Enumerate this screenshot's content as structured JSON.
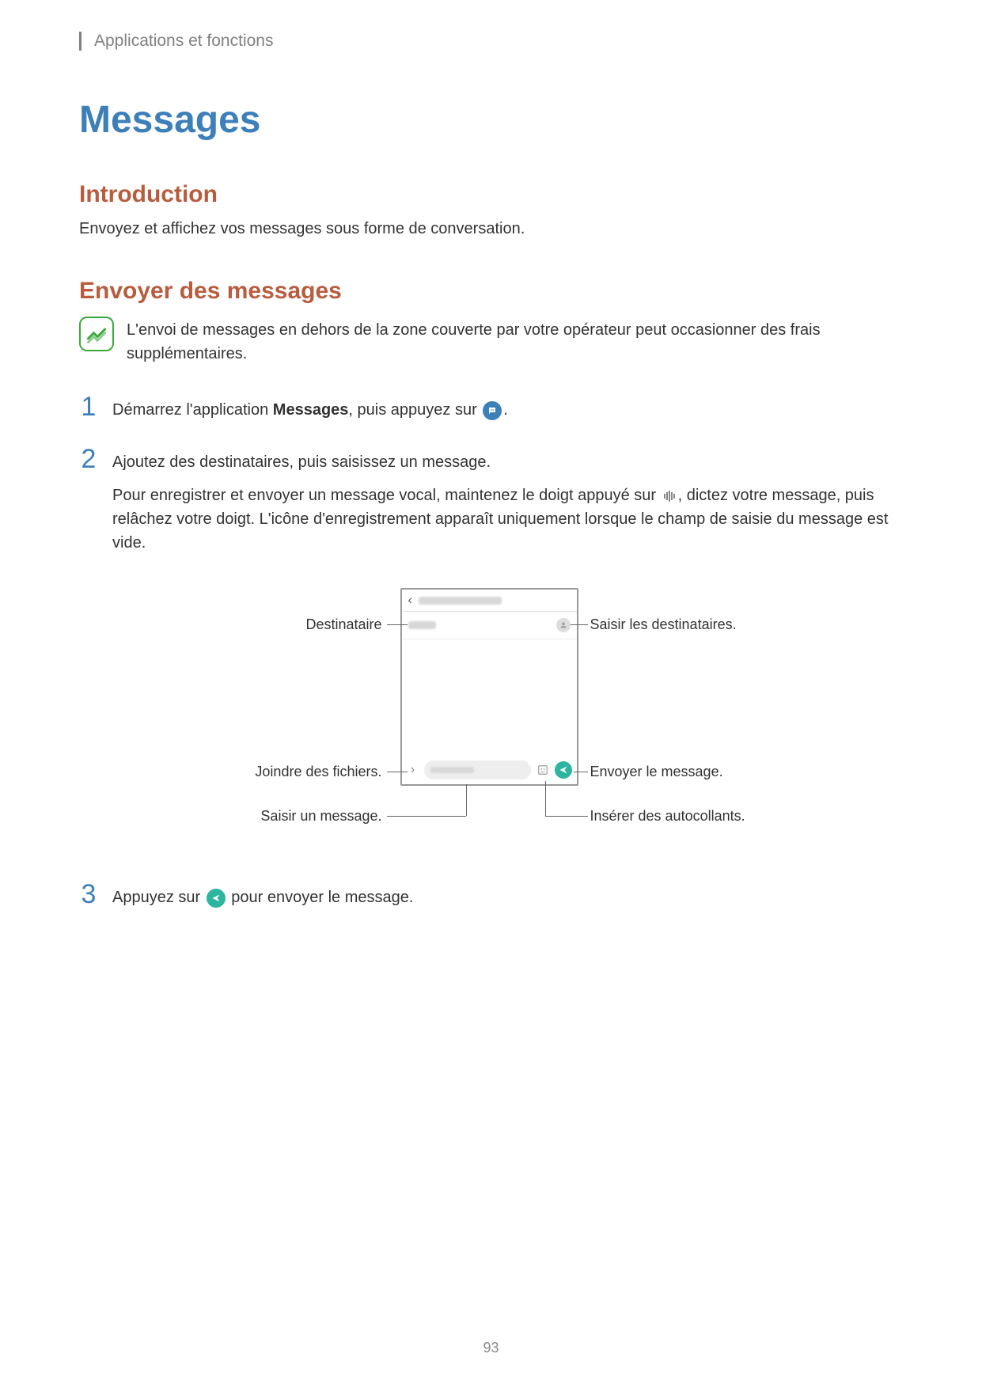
{
  "header": {
    "breadcrumb": "Applications et fonctions"
  },
  "page": {
    "title": "Messages",
    "page_number": "93"
  },
  "section_intro": {
    "heading": "Introduction",
    "body": "Envoyez et affichez vos messages sous forme de conversation."
  },
  "section_send": {
    "heading": "Envoyer des messages",
    "note": "L'envoi de messages en dehors de la zone couverte par votre opérateur peut occasionner des frais supplémentaires.",
    "steps": {
      "s1_prefix": "Démarrez l'application ",
      "s1_bold": "Messages",
      "s1_suffix_before_icon": ", puis appuyez sur ",
      "s1_suffix_after_icon": ".",
      "s2_line1": "Ajoutez des destinataires, puis saisissez un message.",
      "s2_line2_before": "Pour enregistrer et envoyer un message vocal, maintenez le doigt appuyé sur ",
      "s2_line2_after": ", dictez votre message, puis relâchez votre doigt. L'icône d'enregistrement apparaît uniquement lorsque le champ de saisie du message est vide.",
      "s3_before": "Appuyez sur ",
      "s3_after": " pour envoyer le message."
    },
    "step_numbers": {
      "one": "1",
      "two": "2",
      "three": "3"
    }
  },
  "diagram": {
    "labels": {
      "recipient": "Destinataire",
      "enter_recipients": "Saisir les destinataires.",
      "attach_files": "Joindre des fichiers.",
      "send_message": "Envoyer le message.",
      "enter_message": "Saisir un message.",
      "insert_stickers": "Insérer des autocollants."
    }
  }
}
